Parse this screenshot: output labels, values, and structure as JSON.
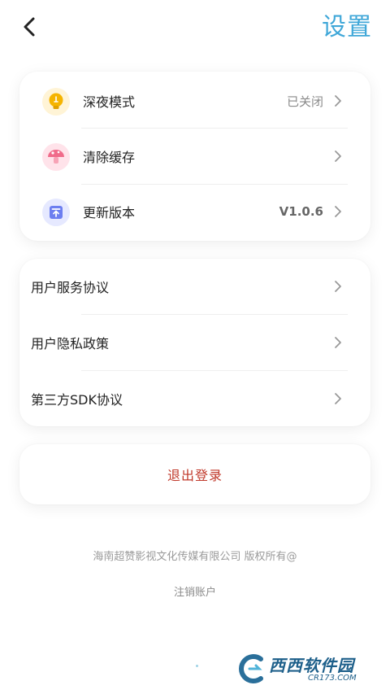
{
  "header": {
    "title": "设置",
    "back_icon": "chevron-left-icon"
  },
  "general": {
    "items": [
      {
        "label": "深夜模式",
        "value": "已关闭",
        "icon": "lightbulb-icon",
        "icon_color": "#f5b400"
      },
      {
        "label": "清除缓存",
        "value": "",
        "icon": "mushroom-icon",
        "icon_color": "#f06b8a"
      },
      {
        "label": "更新版本",
        "value": "V1.0.6",
        "icon": "upload-icon",
        "icon_color": "#6c7ef0"
      }
    ]
  },
  "agreements": {
    "items": [
      {
        "label": "用户服务协议"
      },
      {
        "label": "用户隐私政策"
      },
      {
        "label": "第三方SDK协议"
      }
    ]
  },
  "logout": {
    "label": "退出登录"
  },
  "footer": {
    "company": "海南超赞影视文化传媒有限公司 版权所有@",
    "cancel_account": "注销账户"
  },
  "watermark": {
    "brand": "西西软件园",
    "url": "CR173.COM"
  },
  "colors": {
    "accent": "#3fa7d8",
    "logout": "#c0392b"
  }
}
